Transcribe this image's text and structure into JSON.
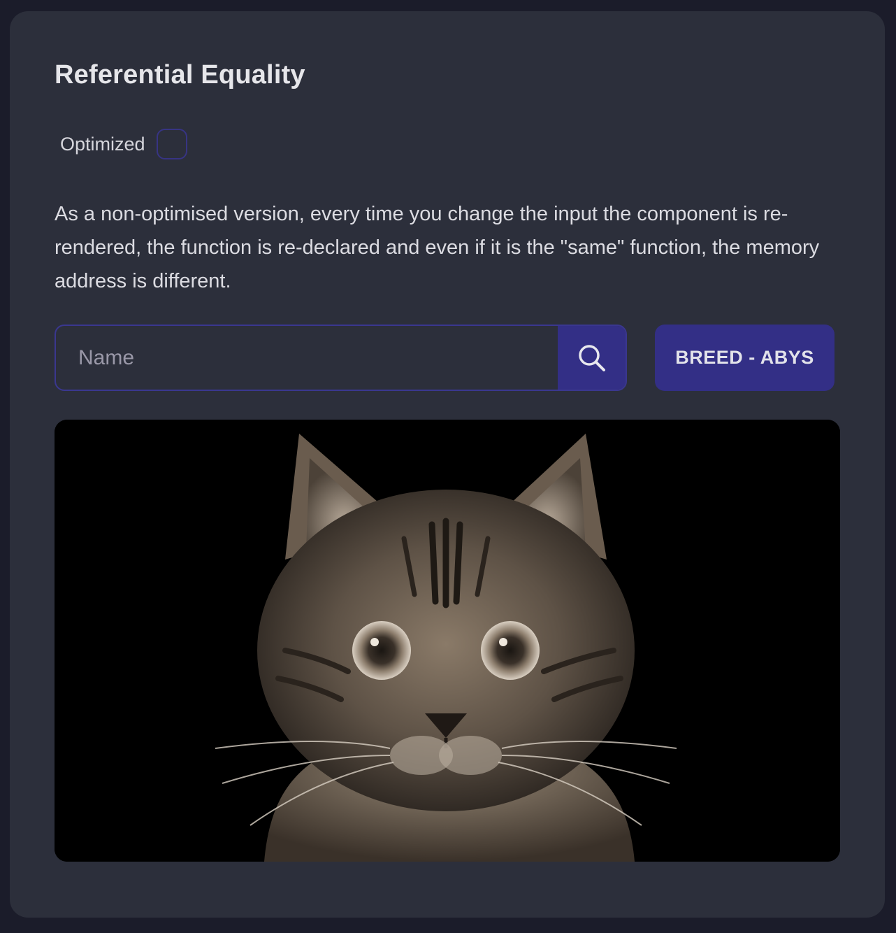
{
  "card": {
    "title": "Referential Equality",
    "toggle": {
      "label": "Optimized",
      "checked": false
    },
    "description": "As a non-optimised version, every time you change the input the component is re-rendered, the function is re-declared and even if it is the \"same\" function, the memory address is different.",
    "search": {
      "value": "",
      "placeholder": "Name",
      "icon": "search-icon"
    },
    "breed_button_label": "BREED - ABYS",
    "image": {
      "subject": "cat-photo"
    }
  },
  "colors": {
    "page_background": "#1b1c2a",
    "card_background": "#2c2f3b",
    "accent": "#332f86",
    "text": "#dcdce2"
  }
}
